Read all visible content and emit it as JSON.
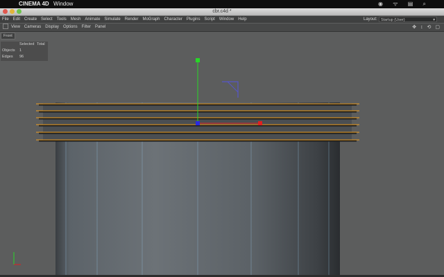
{
  "mac_menubar": {
    "app_name": "CINEMA 4D",
    "window_menu": "Window",
    "status_icons": "◉ ᯤ ▤ ⌕"
  },
  "window": {
    "title": "cbr.c4d *"
  },
  "menu": {
    "items": [
      "File",
      "Edit",
      "Create",
      "Select",
      "Tools",
      "Mesh",
      "Animate",
      "Simulate",
      "Render",
      "MoGraph",
      "Character",
      "Plugins",
      "Script",
      "Window",
      "Help"
    ],
    "layout_label": "Layout:",
    "layout_value": "Startup (User)"
  },
  "viewport_menu": {
    "items": [
      "View",
      "Cameras",
      "Display",
      "Options",
      "Filter",
      "Panel"
    ]
  },
  "viewport": {
    "name": "Front",
    "hud": {
      "col_selected": "Selected",
      "col_total": "Total",
      "rows": [
        {
          "label": "Objects",
          "value": "1"
        },
        {
          "label": "Edges",
          "value": "96"
        }
      ]
    }
  },
  "colors": {
    "axis_y": "#27d827",
    "axis_x": "#e02020",
    "axis_z": "#2a2ae0",
    "edge_highlight": "#f0a020",
    "mesh_line": "#7fa9c8"
  },
  "icons": [
    "apple-icon",
    "move-view-icon",
    "scroll-view-icon",
    "zoom-view-icon",
    "maximize-view-icon"
  ]
}
